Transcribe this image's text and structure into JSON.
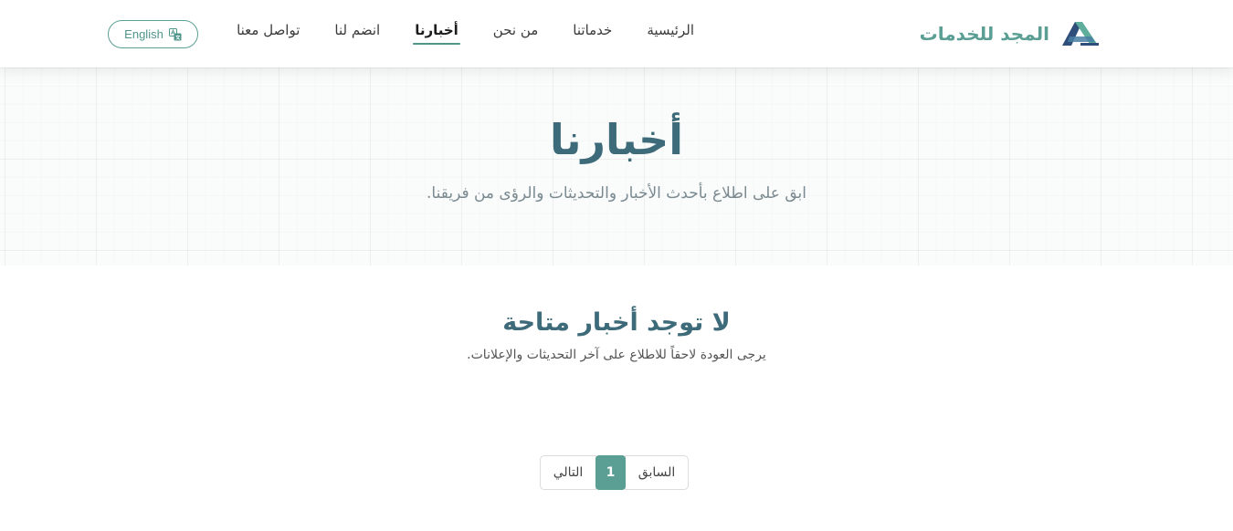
{
  "brand": {
    "name": "المجد للخدمات",
    "logo_icon": "brand-logo-icon",
    "color": "#5a9e94"
  },
  "nav": {
    "items": [
      {
        "label": "الرئيسية",
        "active": false
      },
      {
        "label": "خدماتنا",
        "active": false
      },
      {
        "label": "من نحن",
        "active": false
      },
      {
        "label": "أخبارنا",
        "active": true
      },
      {
        "label": "انضم لنا",
        "active": false
      },
      {
        "label": "تواصل معنا",
        "active": false
      }
    ],
    "language_button": {
      "label": "English",
      "icon": "translate-icon"
    }
  },
  "hero": {
    "title": "أخبارنا",
    "subtitle": "ابق على اطلاع بأحدث الأخبار والتحديثات والرؤى من فريقنا."
  },
  "empty_state": {
    "title": "لا توجد أخبار متاحة",
    "text": "يرجى العودة لاحقاً للاطلاع على آخر التحديثات والإعلانات."
  },
  "pagination": {
    "next_label": "التالي",
    "current_page": "1",
    "prev_label": "السابق"
  },
  "colors": {
    "accent": "#5a9e94",
    "heading": "#3e6b7a"
  }
}
